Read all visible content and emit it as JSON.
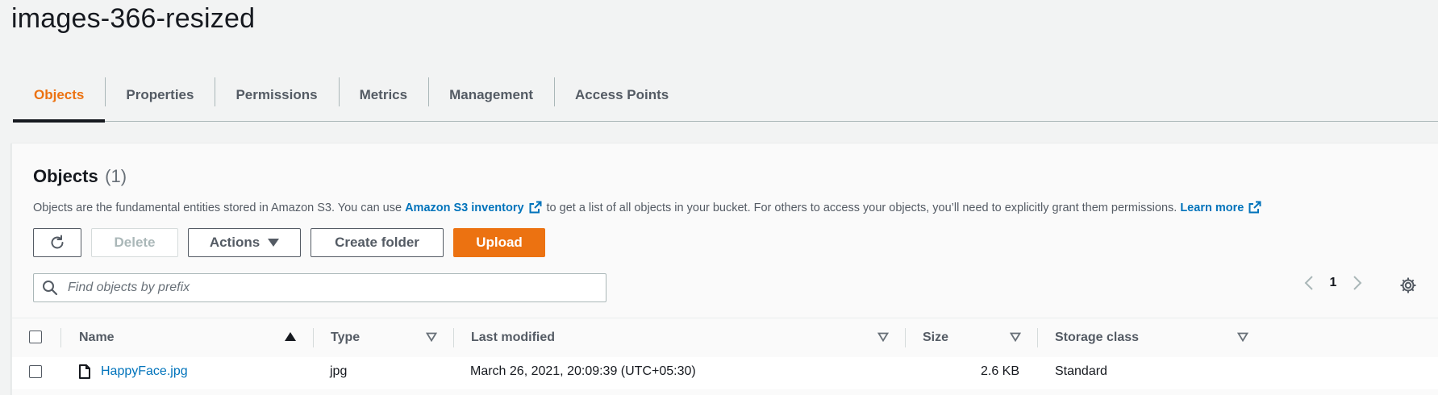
{
  "bucket": {
    "name": "images-366-resized"
  },
  "tabs": [
    {
      "label": "Objects",
      "active": true
    },
    {
      "label": "Properties"
    },
    {
      "label": "Permissions"
    },
    {
      "label": "Metrics"
    },
    {
      "label": "Management"
    },
    {
      "label": "Access Points"
    }
  ],
  "objects_panel": {
    "title": "Objects",
    "count": "(1)",
    "description": {
      "part1": "Objects are the fundamental entities stored in Amazon S3. You can use",
      "inventory_link": "Amazon S3 inventory",
      "part2": "to get a list of all objects in your bucket. For others to access your objects, you’ll need to explicitly grant them permissions.",
      "learn_more": "Learn more"
    },
    "toolbar": {
      "delete_label": "Delete",
      "actions_label": "Actions",
      "create_folder_label": "Create folder",
      "upload_label": "Upload"
    },
    "search": {
      "placeholder": "Find objects by prefix",
      "value": ""
    },
    "pagination": {
      "current_page": "1"
    }
  },
  "table": {
    "columns": [
      "Name",
      "Type",
      "Last modified",
      "Size",
      "Storage class"
    ],
    "rows": [
      {
        "name": "HappyFace.jpg",
        "type": "jpg",
        "last_modified": "March 26, 2021, 20:09:39 (UTC+05:30)",
        "size": "2.6 KB",
        "storage_class": "Standard"
      }
    ]
  },
  "colors": {
    "accent": "#ec7211",
    "link": "#0073bb",
    "text": "#16191f",
    "muted": "#545b64"
  },
  "icons": [
    "refresh-icon",
    "caret-down-icon",
    "search-icon",
    "chevron-left-icon",
    "chevron-right-icon",
    "gear-icon",
    "external-link-icon",
    "sort-ascending-icon",
    "sort-descending-icon",
    "file-icon"
  ]
}
